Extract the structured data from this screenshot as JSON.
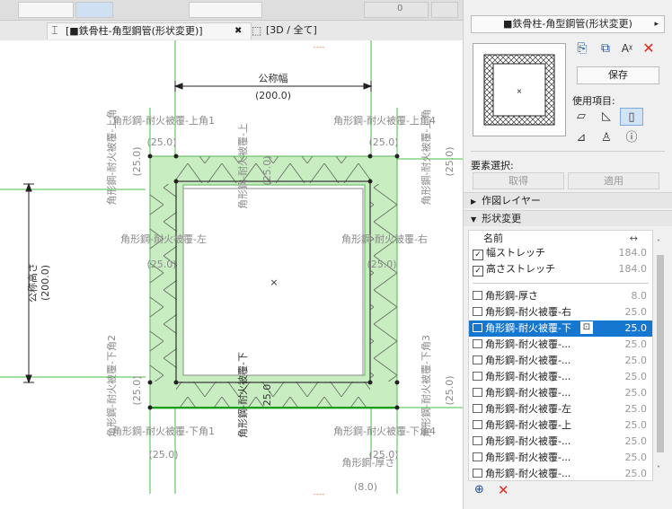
{
  "toolbar": {
    "field_value": "0"
  },
  "tabs": [
    {
      "label": "[■鉄骨柱-角型鋼管(形状変更)]",
      "close": "✖"
    },
    {
      "label": "[3D / 全て]"
    }
  ],
  "canvas": {
    "top_marker": "----",
    "bottom_marker": "----",
    "width_param": {
      "name": "公称幅",
      "value": "(200.0)"
    },
    "height_param": {
      "name": "公称高さ",
      "value": "(200.0)"
    },
    "corner_top_left": {
      "name": "角形鋼-耐火被覆-上角1",
      "value": "(25.0)"
    },
    "corner_top_right": {
      "name": "角形鋼-耐火被覆-上角4",
      "value": "(25.0)"
    },
    "corner_bottom_left": {
      "name": "角形鋼-耐火被覆-下角1",
      "value": "(25.0)"
    },
    "corner_bottom_right": {
      "name": "角形鋼-耐火被覆-下角4",
      "value": "(25.0)"
    },
    "left_cover": {
      "name": "角形鋼-耐火被覆-左",
      "value": "(25.0)"
    },
    "right_cover": {
      "name": "角形鋼-耐火被覆-右",
      "value": "(25.0)"
    },
    "top_cover": {
      "name": "角形鋼-耐火被覆-上",
      "value": "(25.0)"
    },
    "bottom_cover": {
      "name": "角形鋼-耐火被覆-下",
      "value": "25.0"
    },
    "side_top_left": {
      "name": "角形鋼-耐火被覆-上角",
      "value": "(25.0)"
    },
    "side_top_right": {
      "name": "角形鋼-耐火被覆-上角",
      "value": "(25.0)"
    },
    "side_bottom_left": {
      "name": "角形鋼-耐火被覆-下角2",
      "value": "(25.0)"
    },
    "side_bottom_right": {
      "name": "角形鋼-耐火被覆-下角3",
      "value": "(25.0)"
    },
    "thickness": {
      "name": "角形鋼-厚さ",
      "value": "(8.0)"
    },
    "center_mark": "×"
  },
  "panel": {
    "title": "■鉄骨柱-角型鋼管(形状変更)",
    "title_arrow": "▸",
    "save_label": "保存",
    "use_items_label": "使用項目:",
    "element_select_label": "要素選択:",
    "get_label": "取得",
    "apply_label": "適用",
    "section_layer": "作図レイヤー",
    "section_shape": "形状変更",
    "table_header_name": "名前",
    "table_header_icon": "↔",
    "checkbox_rows": [
      {
        "name": "幅ストレッチ",
        "value": "184.0"
      },
      {
        "name": "高さストレッチ",
        "value": "184.0"
      }
    ],
    "param_rows": [
      {
        "name": "角形鋼-厚さ",
        "value": "8.0"
      },
      {
        "name": "角形鋼-耐火被覆-右",
        "value": "25.0"
      },
      {
        "name": "角形鋼-耐火被覆-下",
        "value": "25.0"
      },
      {
        "name": "角形鋼-耐火被覆-...",
        "value": "25.0"
      },
      {
        "name": "角形鋼-耐火被覆-...",
        "value": "25.0"
      },
      {
        "name": "角形鋼-耐火被覆-...",
        "value": "25.0"
      },
      {
        "name": "角形鋼-耐火被覆-...",
        "value": "25.0"
      },
      {
        "name": "角形鋼-耐火被覆-左",
        "value": "25.0"
      },
      {
        "name": "角形鋼-耐火被覆-上",
        "value": "25.0"
      },
      {
        "name": "角形鋼-耐火被覆-...",
        "value": "25.0"
      },
      {
        "name": "角形鋼-耐火被覆-...",
        "value": "25.0"
      },
      {
        "name": "角形鋼-耐火被覆-...",
        "value": "25.0"
      }
    ],
    "selected_row_index": 2,
    "colors": {
      "selection": "#1677d1",
      "guide_green": "#33cc33",
      "fill_green": "#c8edc0",
      "close_red": "#e0281e"
    }
  }
}
